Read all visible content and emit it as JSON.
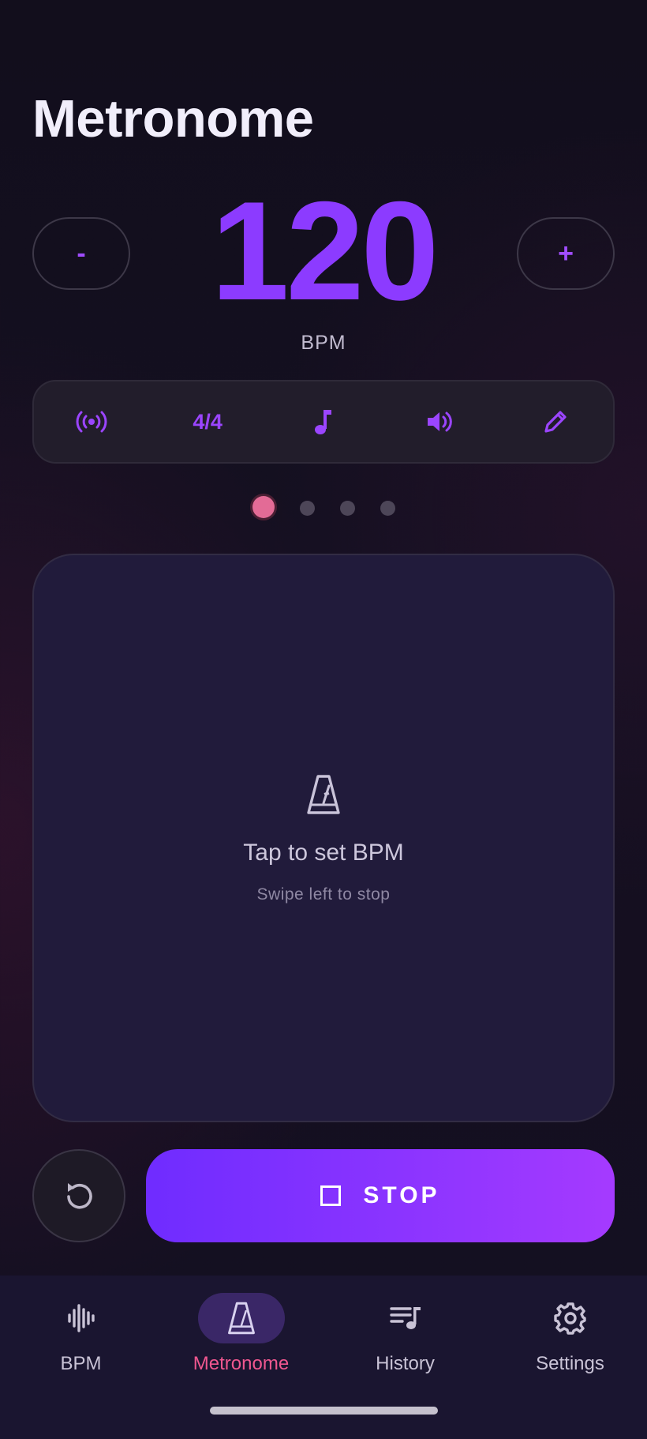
{
  "header": {
    "title": "Metronome"
  },
  "tempo": {
    "decrement_label": "-",
    "value": "120",
    "unit": "BPM",
    "increment_label": "+"
  },
  "quickbar": {
    "items": [
      {
        "icon": "broadcast-icon"
      },
      {
        "label": "4/4"
      },
      {
        "icon": "music-note-icon"
      },
      {
        "icon": "volume-icon"
      },
      {
        "icon": "pencil-icon"
      }
    ]
  },
  "beat_indicator": {
    "count": 4,
    "active_index": 0
  },
  "tap_area": {
    "icon": "metronome-icon",
    "title": "Tap to set BPM",
    "subtitle": "Swipe left to stop"
  },
  "controls": {
    "reset_icon": "reset-icon",
    "stop_label": "STOP",
    "stop_icon": "stop-square-icon"
  },
  "nav": {
    "items": [
      {
        "label": "BPM",
        "icon": "waveform-icon",
        "active": false
      },
      {
        "label": "Metronome",
        "icon": "metronome-icon",
        "active": true
      },
      {
        "label": "History",
        "icon": "playlist-icon",
        "active": false
      },
      {
        "label": "Settings",
        "icon": "gear-icon",
        "active": false
      }
    ]
  },
  "colors": {
    "accent": "#8c3bff",
    "active_nav": "#f0578f",
    "beat_active": "#e36b96"
  }
}
